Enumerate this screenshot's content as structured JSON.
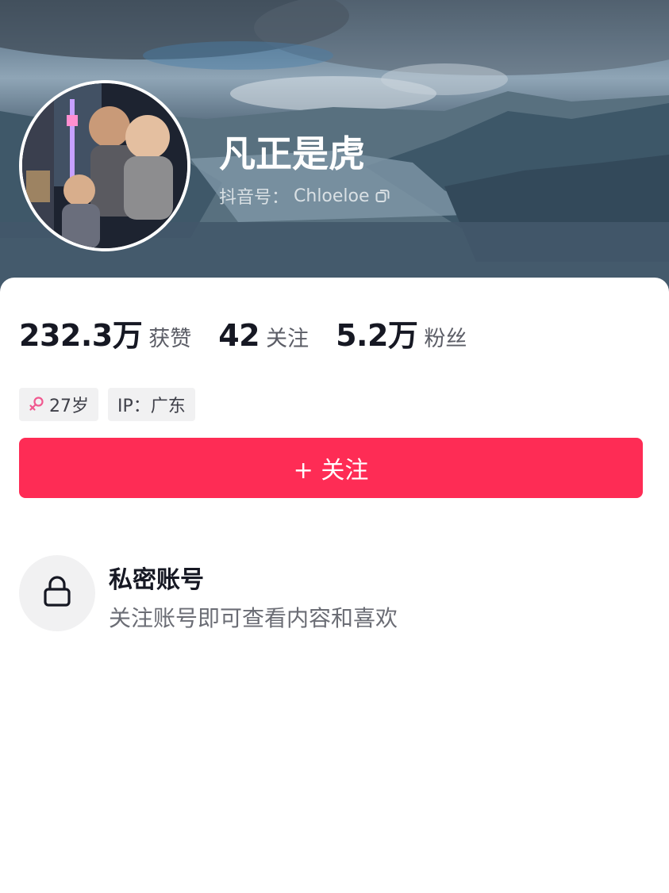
{
  "profile": {
    "name": "凡正是虎",
    "douyin_id_label": "抖音号：",
    "douyin_id": "Chloeloe"
  },
  "stats": [
    {
      "value": "232.3万",
      "label": "获赞"
    },
    {
      "value": "42",
      "label": "关注"
    },
    {
      "value": "5.2万",
      "label": "粉丝"
    }
  ],
  "tags": {
    "age": "27岁",
    "ip": "IP：广东"
  },
  "follow_button": {
    "label": "+ 关注"
  },
  "private_account": {
    "title": "私密账号",
    "description": "关注账号即可查看内容和喜欢"
  },
  "colors": {
    "accent": "#fe2c55",
    "gender_icon": "#f0588f"
  },
  "icons": [
    "copy-icon",
    "female-icon",
    "lock-icon"
  ]
}
